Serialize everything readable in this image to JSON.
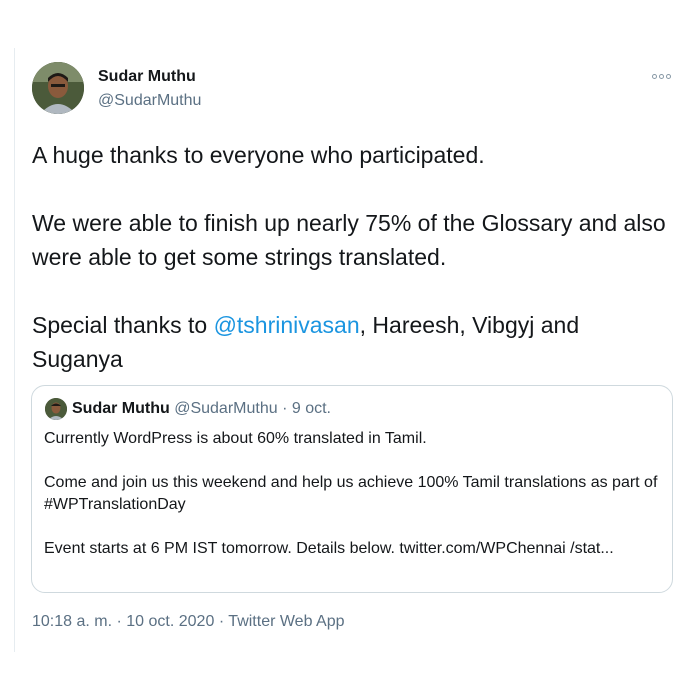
{
  "author": {
    "name": "Sudar Muthu",
    "handle": "@SudarMuthu"
  },
  "tweet": {
    "line1": "A huge thanks to everyone who participated.",
    "line2": "We were able to finish up nearly 75% of the Glossary and also were able to get some strings translated.",
    "line3_prefix": "Special thanks to ",
    "line3_mention": "@tshrinivasan",
    "line3_suffix": ", Hareesh, Vibgyj and Suganya"
  },
  "quoted": {
    "name": "Sudar Muthu",
    "handle": "@SudarMuthu",
    "separator": "·",
    "date": "9 oct.",
    "line1": "Currently WordPress is about 60% translated in Tamil.",
    "line2": "Come and join us this weekend and help us achieve 100% Tamil translations as part of #WPTranslationDay",
    "line3": "Event starts at 6 PM IST tomorrow. Details below. twitter.com/WPChennai /stat..."
  },
  "footer": {
    "time": "10:18 a. m.",
    "sep1": "·",
    "date": "10 oct. 2020",
    "sep2": "·",
    "app": "Twitter Web App"
  },
  "colors": {
    "link": "#1b95e0",
    "secondary": "#5b7083",
    "border": "#cfd9de"
  }
}
